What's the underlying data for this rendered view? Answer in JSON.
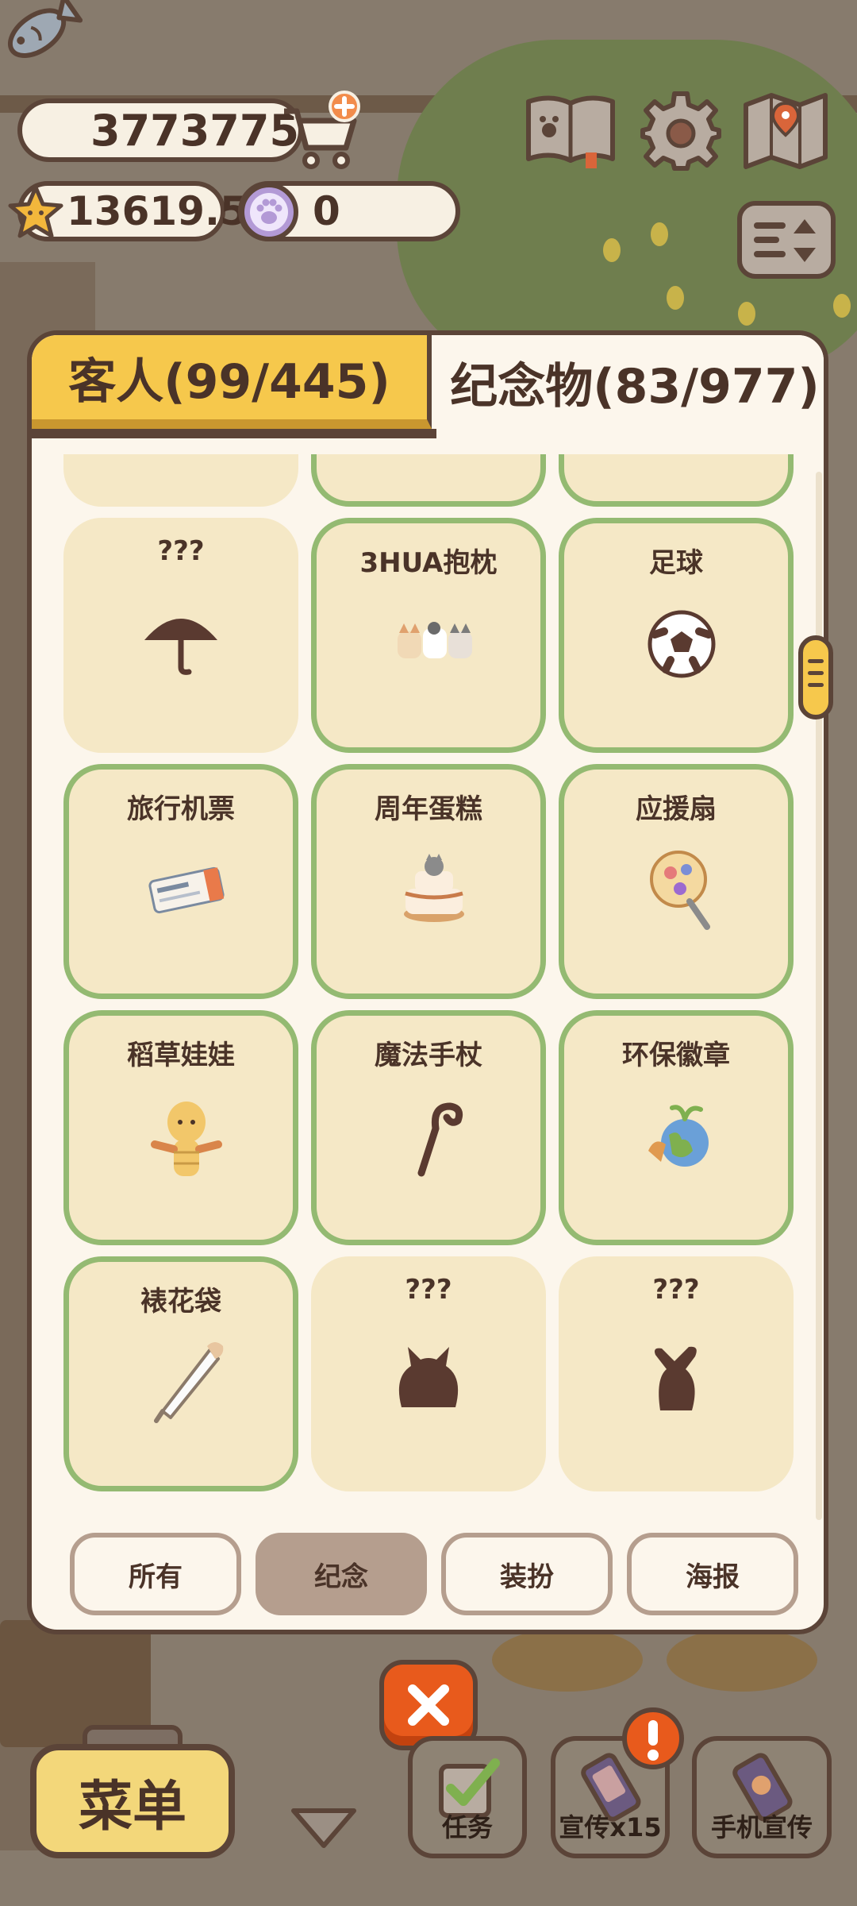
{
  "hud": {
    "fish_count": "3773775",
    "star_count": "13619.5",
    "paw_count": "0"
  },
  "tabs": {
    "guests": "客人(99/445)",
    "souvenirs": "纪念物(83/977)"
  },
  "items": [
    {
      "label": "",
      "owned": false,
      "art": "bag-silhouette-icon"
    },
    {
      "label": "",
      "owned": true,
      "art": "doll-girl-icon"
    },
    {
      "label": "",
      "owned": true,
      "art": "dreamcatcher-icon"
    },
    {
      "label": "???",
      "owned": false,
      "art": "umbrella-silhouette-icon"
    },
    {
      "label": "3HUA抱枕",
      "owned": true,
      "art": "cat-pillow-icon"
    },
    {
      "label": "足球",
      "owned": true,
      "art": "soccer-ball-icon"
    },
    {
      "label": "旅行机票",
      "owned": true,
      "art": "plane-ticket-icon"
    },
    {
      "label": "周年蛋糕",
      "owned": true,
      "art": "anniversary-cake-icon"
    },
    {
      "label": "应援扇",
      "owned": true,
      "art": "cheer-fan-icon"
    },
    {
      "label": "稻草娃娃",
      "owned": true,
      "art": "straw-doll-icon"
    },
    {
      "label": "魔法手杖",
      "owned": true,
      "art": "magic-staff-icon"
    },
    {
      "label": "环保徽章",
      "owned": true,
      "art": "eco-badge-icon"
    },
    {
      "label": "裱花袋",
      "owned": true,
      "art": "piping-bag-icon"
    },
    {
      "label": "???",
      "owned": false,
      "art": "cat-silhouette-icon"
    },
    {
      "label": "???",
      "owned": false,
      "art": "figure-silhouette-icon"
    }
  ],
  "filters": [
    {
      "label": "所有",
      "active": false
    },
    {
      "label": "纪念",
      "active": true
    },
    {
      "label": "装扮",
      "active": false
    },
    {
      "label": "海报",
      "active": false
    }
  ],
  "bottom": {
    "menu": "菜单",
    "task": "任务",
    "promo": "宣传x15",
    "phone_promo": "手机宣传"
  },
  "colors": {
    "panel_bg": "#fcf6ec",
    "outline": "#5b4438",
    "tab_active": "#f6c84c",
    "owned_border": "#94ba72",
    "cell_bg": "#f5e8c6",
    "silhouette": "#5a3a30",
    "filter_active": "#b59e8e",
    "close_button": "#e85a1c"
  }
}
